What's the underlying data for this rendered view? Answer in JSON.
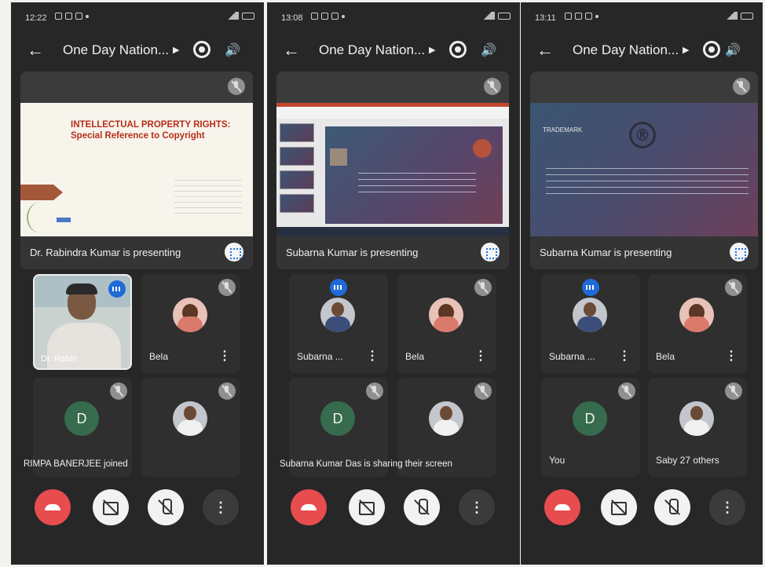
{
  "panels": [
    {
      "status_time": "12:22",
      "meeting_title": "One Day Nation...",
      "presenting_text": "Dr. Rabindra Kumar is presenting",
      "slide_title": "INTELLECTUAL PROPERTY RIGHTS: Special Reference to Copyright",
      "video_name": "Dr. Rabin",
      "tile_bela": "Bela",
      "tile_d": "D",
      "notice": "RIMPA BANERJEE joined"
    },
    {
      "status_time": "13:08",
      "meeting_title": "One Day Nation...",
      "presenting_text": "Subarna Kumar is presenting",
      "tile_subarna": "Subarna ...",
      "tile_bela": "Bela",
      "tile_d": "D",
      "notice": "Subarna Kumar Das is sharing their screen"
    },
    {
      "status_time": "13:11",
      "meeting_title": "One Day Nation...",
      "presenting_text": "Subarna Kumar is presenting",
      "slide_title": "TRADEMARK",
      "slide_symbol": "®",
      "tile_subarna": "Subarna ...",
      "tile_bela": "Bela",
      "tile_d": "D",
      "tile_you": "You",
      "tile_others": "Saby  27 others"
    }
  ],
  "icons": {
    "back": "←",
    "more": "⋮",
    "caret": "▶",
    "speaker": "🔊"
  },
  "colors": {
    "end_call": "#e74c4f",
    "speaking": "#1f6ad8",
    "avatar_d": "#366b4e"
  }
}
